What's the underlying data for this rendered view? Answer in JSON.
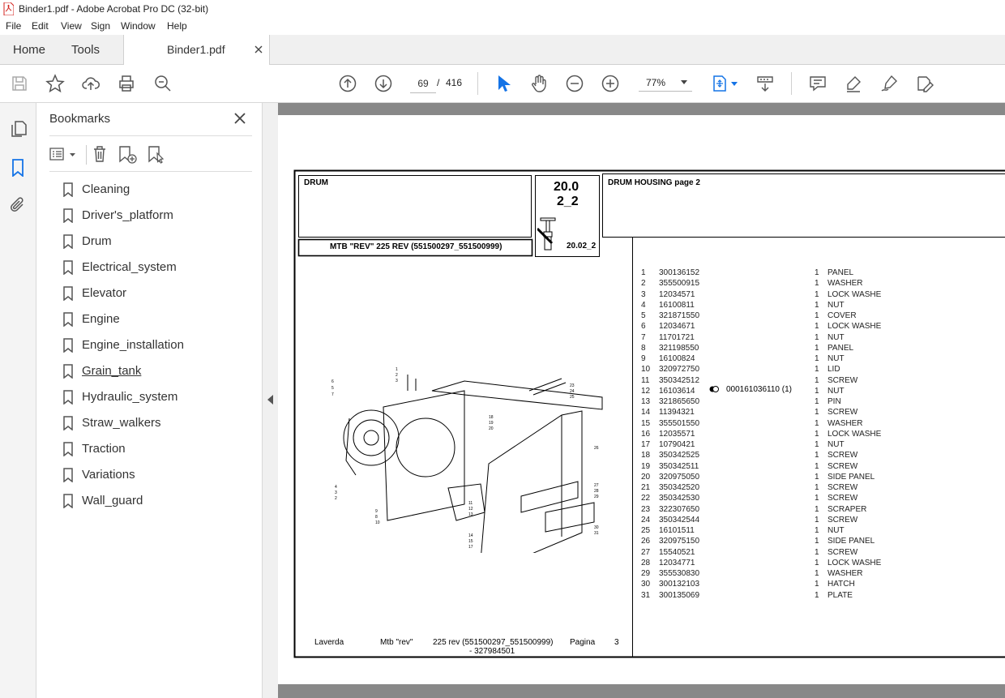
{
  "window": {
    "title": "Binder1.pdf - Adobe Acrobat Pro DC (32-bit)"
  },
  "menu": [
    "File",
    "Edit",
    "View",
    "Sign",
    "Window",
    "Help"
  ],
  "tabs": {
    "home": "Home",
    "tools": "Tools",
    "file": "Binder1.pdf"
  },
  "toolbar": {
    "page_current": "69",
    "page_sep": "/",
    "page_total": "416",
    "zoom": "77%"
  },
  "bookmarks": {
    "title": "Bookmarks",
    "items": [
      "Cleaning",
      "Driver's_platform",
      "Drum",
      "Electrical_system",
      "Elevator",
      "Engine",
      "Engine_installation",
      "Grain_tank",
      "Hydraulic_system",
      "Straw_walkers",
      "Traction",
      "Variations",
      "Wall_guard"
    ],
    "hovered": "Grain_tank"
  },
  "document": {
    "group": "DRUM",
    "ref_line1": "20.0",
    "ref_line2": "2_2",
    "ref_code": "20.02_2",
    "model": "MTB \"REV\" 225 REV (551500297_551500999)",
    "heading": "DRUM HOUSING  page 2",
    "footer": {
      "brand": "Laverda",
      "model": "Mtb \"rev\"",
      "variant": "225 rev (551500297_551500999)",
      "page_label": "Pagina",
      "page_num": "3",
      "code": "- 327984501"
    },
    "note": {
      "row": 12,
      "symbol": "half-filled-circle",
      "text": "000161036110  (1)"
    },
    "parts": [
      [
        "1",
        "300136152",
        "1",
        "PANEL"
      ],
      [
        "2",
        "355500915",
        "1",
        "WASHER"
      ],
      [
        "3",
        "12034571",
        "1",
        "LOCK WASHE"
      ],
      [
        "4",
        "16100811",
        "1",
        "NUT"
      ],
      [
        "5",
        "321871550",
        "1",
        "COVER"
      ],
      [
        "6",
        "12034671",
        "1",
        "LOCK WASHE"
      ],
      [
        "7",
        "11701721",
        "1",
        "NUT"
      ],
      [
        "8",
        "321198550",
        "1",
        "PANEL"
      ],
      [
        "9",
        "16100824",
        "1",
        "NUT"
      ],
      [
        "10",
        "320972750",
        "1",
        "LID"
      ],
      [
        "11",
        "350342512",
        "1",
        "SCREW"
      ],
      [
        "12",
        "16103614",
        "1",
        "NUT"
      ],
      [
        "13",
        "321865650",
        "1",
        "PIN"
      ],
      [
        "14",
        "11394321",
        "1",
        "SCREW"
      ],
      [
        "15",
        "355501550",
        "1",
        "WASHER"
      ],
      [
        "16",
        "12035571",
        "1",
        "LOCK WASHE"
      ],
      [
        "17",
        "10790421",
        "1",
        "NUT"
      ],
      [
        "18",
        "350342525",
        "1",
        "SCREW"
      ],
      [
        "19",
        "350342511",
        "1",
        "SCREW"
      ],
      [
        "20",
        "320975050",
        "1",
        "SIDE PANEL"
      ],
      [
        "21",
        "350342520",
        "1",
        "SCREW"
      ],
      [
        "22",
        "350342530",
        "1",
        "SCREW"
      ],
      [
        "23",
        "322307650",
        "1",
        "SCRAPER"
      ],
      [
        "24",
        "350342544",
        "1",
        "SCREW"
      ],
      [
        "25",
        "16101511",
        "1",
        "NUT"
      ],
      [
        "26",
        "320975150",
        "1",
        "SIDE PANEL"
      ],
      [
        "27",
        "15540521",
        "1",
        "SCREW"
      ],
      [
        "28",
        "12034771",
        "1",
        "LOCK WASHE"
      ],
      [
        "29",
        "355530830",
        "1",
        "WASHER"
      ],
      [
        "30",
        "300132103",
        "1",
        "HATCH"
      ],
      [
        "31",
        "300135069",
        "1",
        "PLATE"
      ]
    ]
  },
  "colors": {
    "accent": "#1473e6",
    "pdf_red": "#d3211d",
    "doc_bg": "#888888"
  }
}
